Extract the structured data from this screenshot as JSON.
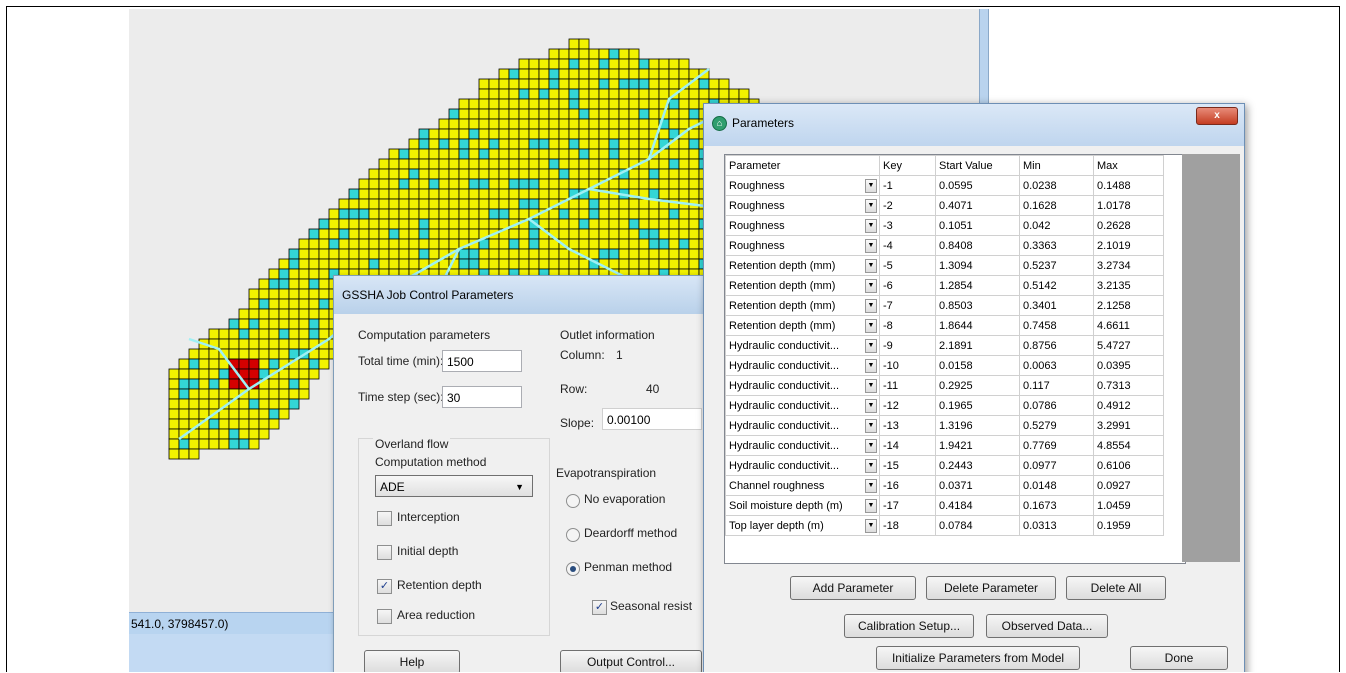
{
  "status_bar": {
    "coordinates": "541.0, 3798457.0)"
  },
  "gssha_dialog": {
    "title": "GSSHA Job Control Parameters",
    "computation_header": "Computation parameters",
    "total_time_label": "Total time (min):",
    "total_time_value": "1500",
    "time_step_label": "Time step (sec):",
    "time_step_value": "30",
    "outlet_header": "Outlet information",
    "column_label": "Column:",
    "column_value": "1",
    "row_label": "Row:",
    "row_value": "40",
    "slope_label": "Slope:",
    "slope_value": "0.00100",
    "overland_header": "Overland flow",
    "computation_method_label": "Computation method",
    "computation_method_value": "ADE",
    "interception": "Interception",
    "initial_depth": "Initial depth",
    "retention_depth": "Retention depth",
    "area_reduction": "Area reduction",
    "evapo_header": "Evapotranspiration",
    "no_evap": "No evaporation",
    "deardorff": "Deardorff method",
    "penman": "Penman method",
    "seasonal": "Seasonal resist",
    "help_button": "Help",
    "output_button": "Output Control..."
  },
  "parameters_dialog": {
    "title": "Parameters",
    "columns": [
      "Parameter",
      "Key",
      "Start Value",
      "Min",
      "Max"
    ],
    "rows": [
      [
        "Roughness",
        "-1",
        "0.0595",
        "0.0238",
        "0.1488"
      ],
      [
        "Roughness",
        "-2",
        "0.4071",
        "0.1628",
        "1.0178"
      ],
      [
        "Roughness",
        "-3",
        "0.1051",
        "0.042",
        "0.2628"
      ],
      [
        "Roughness",
        "-4",
        "0.8408",
        "0.3363",
        "2.1019"
      ],
      [
        "Retention depth (mm)",
        "-5",
        "1.3094",
        "0.5237",
        "3.2734"
      ],
      [
        "Retention depth (mm)",
        "-6",
        "1.2854",
        "0.5142",
        "3.2135"
      ],
      [
        "Retention depth (mm)",
        "-7",
        "0.8503",
        "0.3401",
        "2.1258"
      ],
      [
        "Retention depth (mm)",
        "-8",
        "1.8644",
        "0.7458",
        "4.6611"
      ],
      [
        "Hydraulic conductivit...",
        "-9",
        "2.1891",
        "0.8756",
        "5.4727"
      ],
      [
        "Hydraulic conductivit...",
        "-10",
        "0.0158",
        "0.0063",
        "0.0395"
      ],
      [
        "Hydraulic conductivit...",
        "-11",
        "0.2925",
        "0.117",
        "0.7313"
      ],
      [
        "Hydraulic conductivit...",
        "-12",
        "0.1965",
        "0.0786",
        "0.4912"
      ],
      [
        "Hydraulic conductivit...",
        "-13",
        "1.3196",
        "0.5279",
        "3.2991"
      ],
      [
        "Hydraulic conductivit...",
        "-14",
        "1.9421",
        "0.7769",
        "4.8554"
      ],
      [
        "Hydraulic conductivit...",
        "-15",
        "0.2443",
        "0.0977",
        "0.6106"
      ],
      [
        "Channel roughness",
        "-16",
        "0.0371",
        "0.0148",
        "0.0927"
      ],
      [
        "Soil moisture depth (m)",
        "-17",
        "0.4184",
        "0.1673",
        "1.0459"
      ],
      [
        "Top layer depth (m)",
        "-18",
        "0.0784",
        "0.0313",
        "0.1959"
      ]
    ],
    "add_button": "Add Parameter",
    "delete_button": "Delete Parameter",
    "delete_all_button": "Delete All",
    "calibration_button": "Calibration Setup...",
    "observed_button": "Observed Data...",
    "initialize_button": "Initialize Parameters from Model",
    "done_button": "Done"
  },
  "colors": {
    "land": "#f2f200",
    "water": "#33d6d6",
    "highlight": "#d40000",
    "grid": "#000000"
  }
}
